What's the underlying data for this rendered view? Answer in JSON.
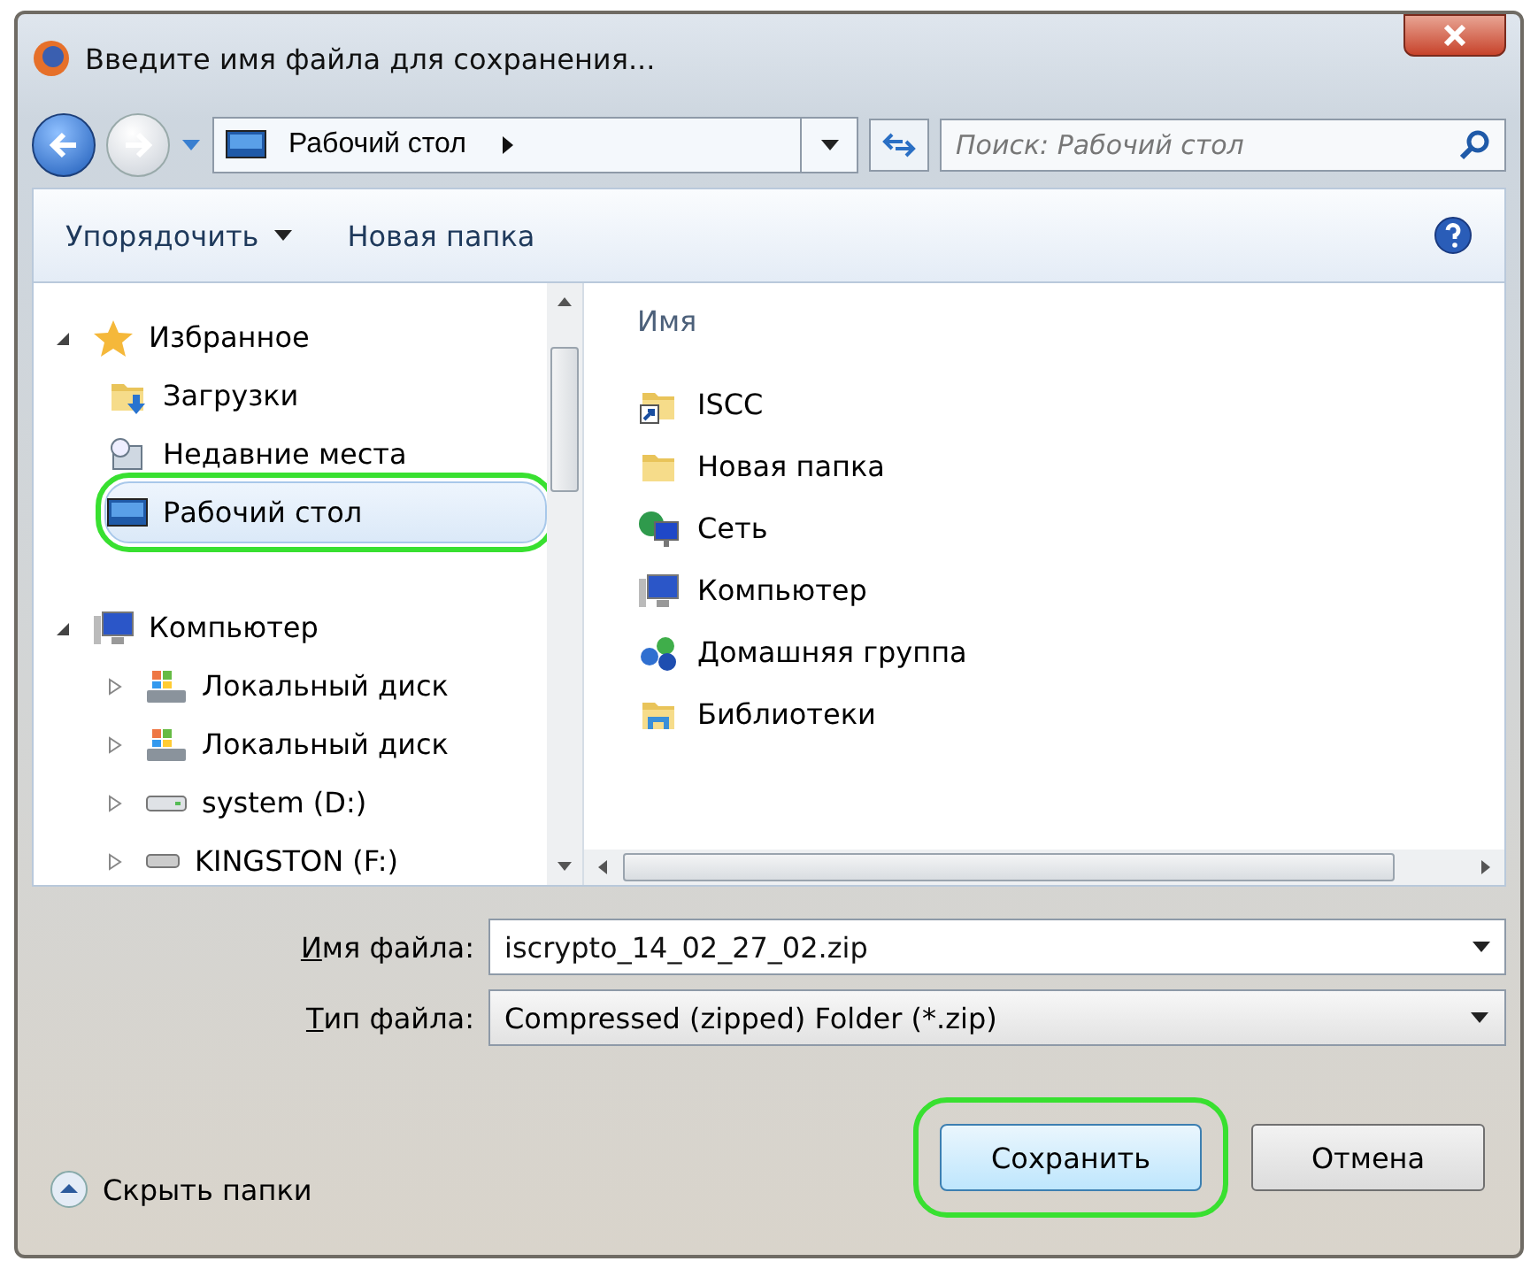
{
  "window": {
    "title": "Введите имя файла для сохранения..."
  },
  "nav": {
    "location": "Рабочий стол",
    "search_placeholder": "Поиск: Рабочий стол"
  },
  "toolbar": {
    "organize": "Упорядочить",
    "new_folder": "Новая папка"
  },
  "sidebar": {
    "items": [
      {
        "label": "Избранное",
        "kind": "star",
        "expanded": true,
        "selected": false,
        "highlighted": false,
        "children": [
          {
            "label": "Загрузки",
            "kind": "downloads",
            "selected": false,
            "highlighted": false
          },
          {
            "label": "Недавние места",
            "kind": "recent",
            "selected": false,
            "highlighted": false
          },
          {
            "label": "Рабочий стол",
            "kind": "desktop",
            "selected": true,
            "highlighted": true
          }
        ]
      },
      {
        "label": "Компьютер",
        "kind": "computer",
        "expanded": true,
        "selected": false,
        "highlighted": false,
        "children": [
          {
            "label": "Локальный диск",
            "kind": "windrive",
            "expanded": false,
            "selected": false,
            "highlighted": false
          },
          {
            "label": "Локальный диск",
            "kind": "windrive",
            "expanded": false,
            "selected": false,
            "highlighted": false
          },
          {
            "label": "system (D:)",
            "kind": "drive",
            "expanded": false,
            "selected": false,
            "highlighted": false
          },
          {
            "label": "KINGSTON (F:)",
            "kind": "usb",
            "expanded": false,
            "selected": false,
            "highlighted": false
          }
        ]
      }
    ]
  },
  "content": {
    "column": "Имя",
    "items": [
      {
        "label": "ISCC",
        "kind": "shortcut"
      },
      {
        "label": "Новая папка",
        "kind": "folder"
      },
      {
        "label": "Сеть",
        "kind": "network"
      },
      {
        "label": "Компьютер",
        "kind": "computer"
      },
      {
        "label": "Домашняя группа",
        "kind": "homegroup"
      },
      {
        "label": "Библиотеки",
        "kind": "library"
      }
    ]
  },
  "form": {
    "filename_label": "Имя файла:",
    "filename": "iscrypto_14_02_27_02.zip",
    "type_label": "Тип файла:",
    "type": "Compressed (zipped) Folder (*.zip)"
  },
  "footer": {
    "hide_folders": "Скрыть папки",
    "buttons": [
      {
        "label": "Сохранить",
        "kind": "default",
        "highlighted": true
      },
      {
        "label": "Отмена",
        "kind": "normal",
        "highlighted": false
      }
    ]
  }
}
